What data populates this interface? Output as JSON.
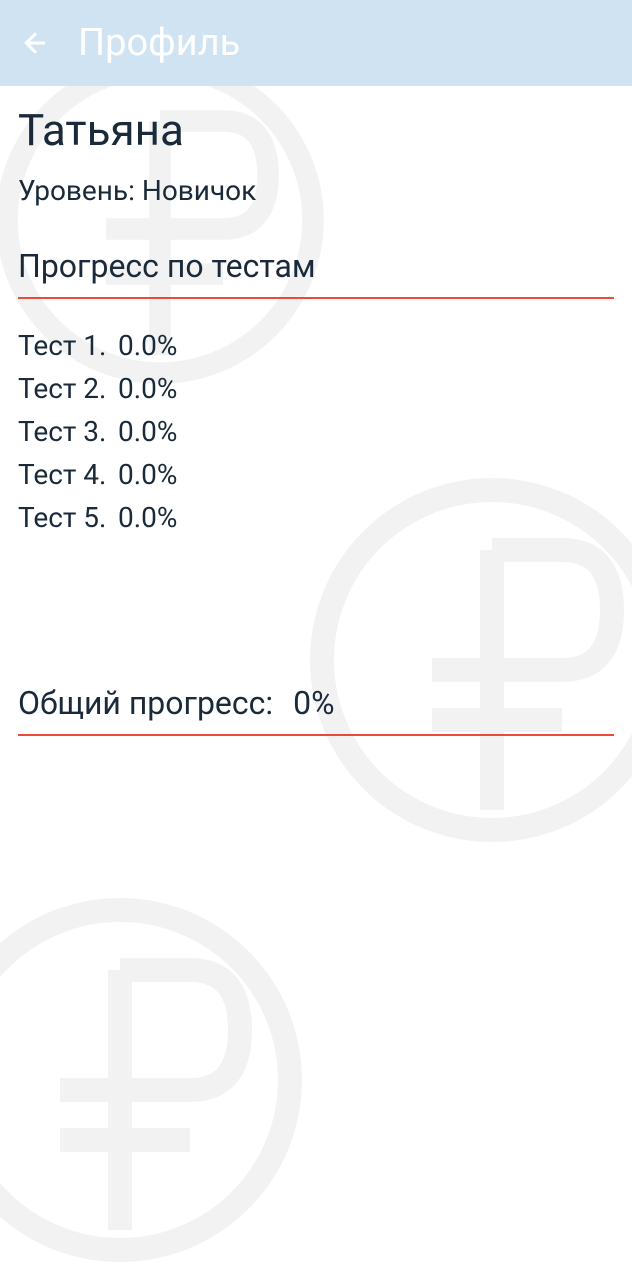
{
  "header": {
    "title": "Профиль"
  },
  "profile": {
    "name": "Татьяна",
    "level_label": "Уровень: Новичок"
  },
  "progress": {
    "section_title": "Прогресс по тестам",
    "tests": [
      {
        "label": "Тест 1.",
        "value": "0.0%"
      },
      {
        "label": "Тест 2.",
        "value": "0.0%"
      },
      {
        "label": "Тест 3.",
        "value": "0.0%"
      },
      {
        "label": "Тест 4.",
        "value": "0.0%"
      },
      {
        "label": "Тест 5.",
        "value": "0.0%"
      }
    ]
  },
  "overall": {
    "label": "Общий прогресс:",
    "value": "0%"
  }
}
